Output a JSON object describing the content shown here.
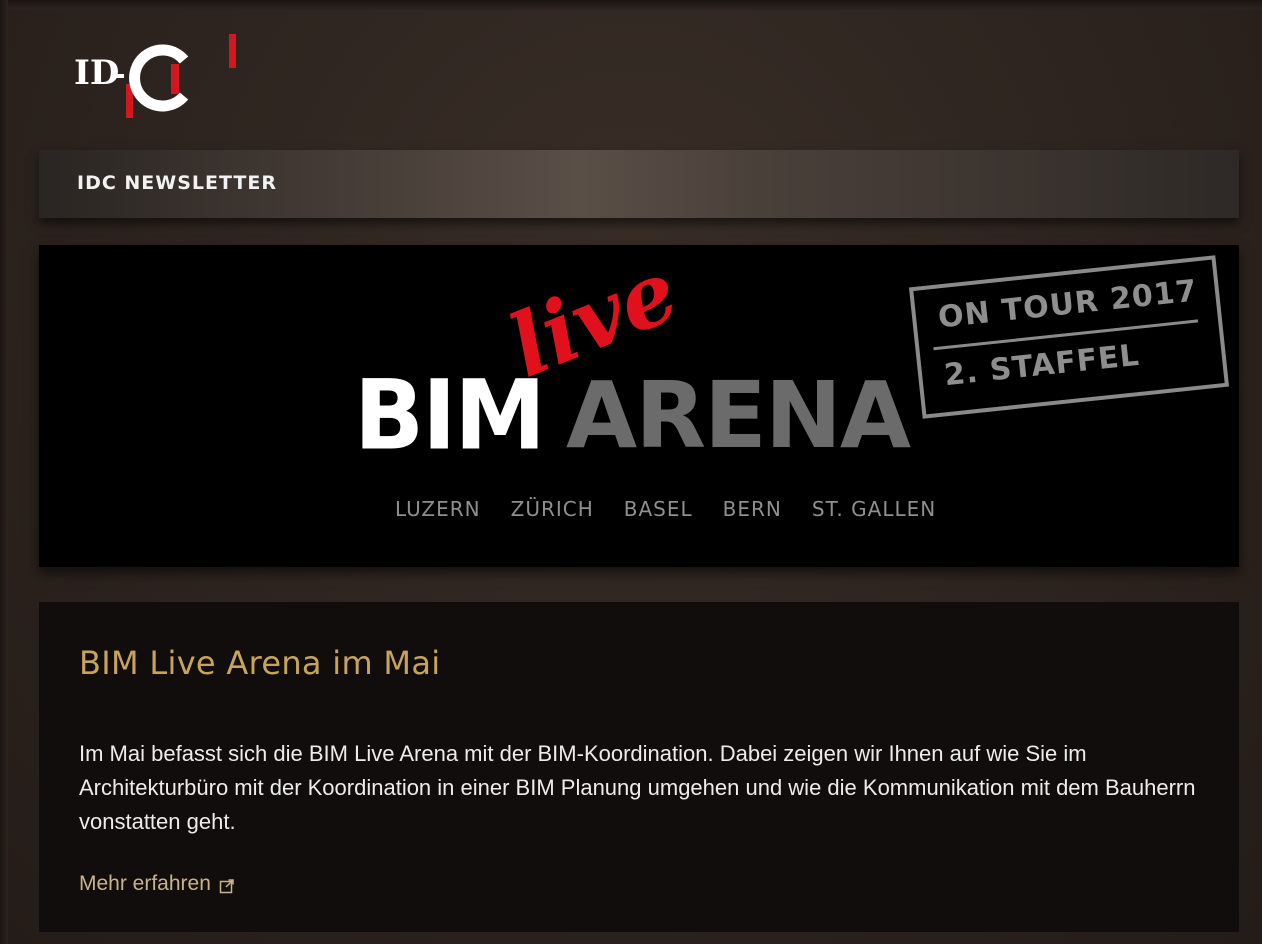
{
  "header": {
    "logo_text": "ID-C",
    "newsletter_label": "IDC NEWSLETTER"
  },
  "banner": {
    "bim": "BIM",
    "live": "live",
    "arena": "ARENA",
    "stamp_line1": "ON TOUR 2017",
    "stamp_line2": "2. STAFFEL",
    "cities": [
      "LUZERN",
      "ZÜRICH",
      "BASEL",
      "BERN",
      "ST. GALLEN"
    ]
  },
  "article": {
    "title": "BIM Live Arena im Mai",
    "body": "Im Mai befasst sich die BIM Live Arena mit der BIM-Koordination. Dabei zeigen wir Ihnen auf wie Sie im Architekturbüro mit der Koordination in einer BIM Planung umgehen und wie die Kommunikation mit dem Bauherrn vonstatten geht.",
    "link_label": "Mehr erfahren",
    "link_icon": "external-link-icon"
  },
  "colors": {
    "accent_gold": "#c8a45a",
    "live_red": "#e0101c",
    "logo_red": "#d3171f"
  }
}
